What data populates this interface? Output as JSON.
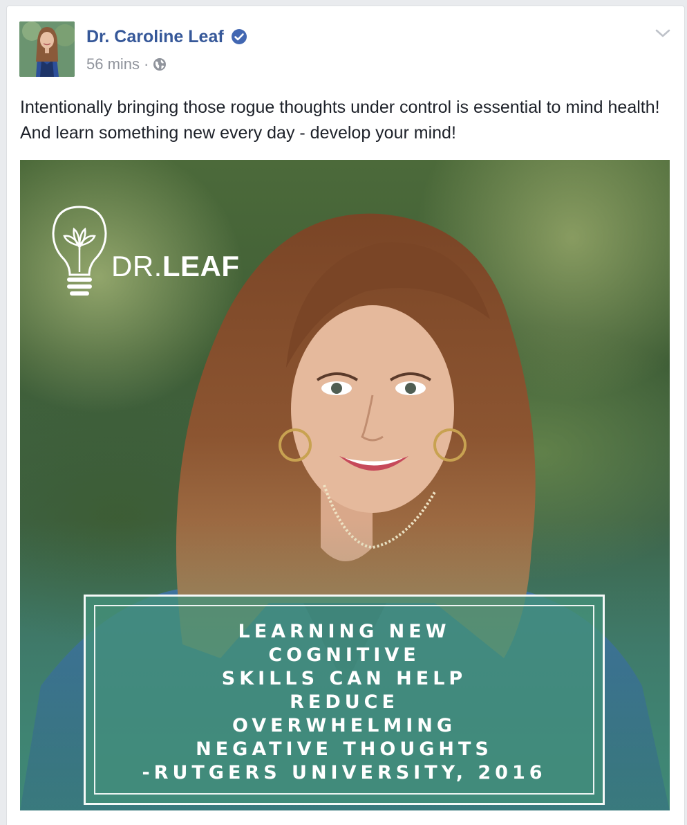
{
  "post": {
    "author_name": "Dr. Caroline Leaf",
    "timestamp": "56 mins",
    "separator": "·",
    "privacy_icon": "globe-icon",
    "verified_icon": "verified-badge-icon",
    "menu_icon": "chevron-down-icon",
    "text": "Intentionally bringing those rogue thoughts under control is essential to mind health! And learn something new every day - develop your mind!"
  },
  "image": {
    "logo_icon": "lightbulb-leaf-icon",
    "logo_text_light": "DR.",
    "logo_text_bold": "LEAF",
    "quote_lines": [
      "LEARNING NEW",
      "COGNITIVE",
      "SKILLS CAN HELP",
      "REDUCE",
      "OVERWHELMING",
      "NEGATIVE THOUGHTS",
      "-RUTGERS UNIVERSITY, 2016"
    ]
  },
  "colors": {
    "author_link": "#365899",
    "meta_text": "#90949c",
    "body_text": "#1d2129",
    "verified_blue": "#4267b2",
    "quote_box_teal": "#44917a"
  }
}
